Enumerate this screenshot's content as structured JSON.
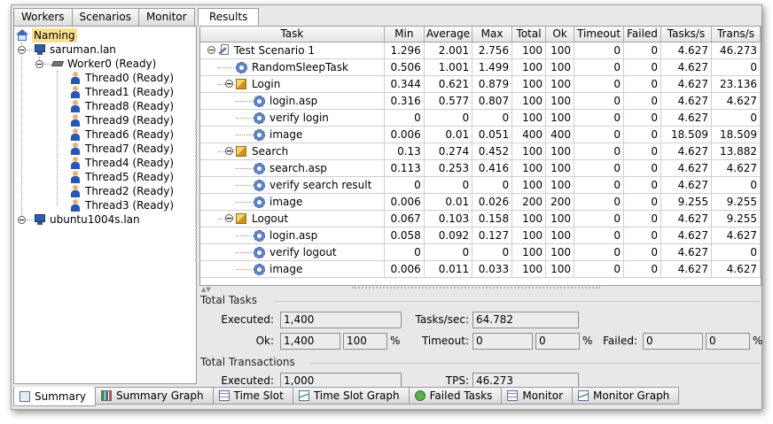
{
  "left_tabs": [
    "Workers",
    "Scenarios",
    "Monitor"
  ],
  "right_tab": "Results",
  "tree": {
    "root": "Naming",
    "hosts": [
      {
        "name": "saruman.lan",
        "worker": "Worker0 (Ready)",
        "threads": [
          "Thread0 (Ready)",
          "Thread1 (Ready)",
          "Thread8 (Ready)",
          "Thread9 (Ready)",
          "Thread6 (Ready)",
          "Thread7 (Ready)",
          "Thread4 (Ready)",
          "Thread5 (Ready)",
          "Thread2 (Ready)",
          "Thread3 (Ready)"
        ]
      },
      {
        "name": "ubuntu1004s.lan"
      }
    ]
  },
  "table": {
    "columns": [
      "Task",
      "Min",
      "Average",
      "Max",
      "Total",
      "Ok",
      "Timeout",
      "Failed",
      "Tasks/s",
      "Trans/s"
    ],
    "rows": [
      {
        "task": "Test Scenario 1",
        "icon": "scenario",
        "min": "1.296",
        "avg": "2.001",
        "max": "2.756",
        "total": "100",
        "ok": "100",
        "timeout": "0",
        "failed": "0",
        "tps": "4.627",
        "trans": "46.273"
      },
      {
        "task": "RandomSleepTask",
        "icon": "gear",
        "min": "0.506",
        "avg": "1.001",
        "max": "1.499",
        "total": "100",
        "ok": "100",
        "timeout": "0",
        "failed": "0",
        "tps": "4.627",
        "trans": "0"
      },
      {
        "task": "Login",
        "icon": "cube",
        "min": "0.344",
        "avg": "0.621",
        "max": "0.879",
        "total": "100",
        "ok": "100",
        "timeout": "0",
        "failed": "0",
        "tps": "4.627",
        "trans": "23.136"
      },
      {
        "task": "login.asp",
        "icon": "gear",
        "min": "0.316",
        "avg": "0.577",
        "max": "0.807",
        "total": "100",
        "ok": "100",
        "timeout": "0",
        "failed": "0",
        "tps": "4.627",
        "trans": "4.627"
      },
      {
        "task": "verify login",
        "icon": "gear",
        "min": "0",
        "avg": "0",
        "max": "0",
        "total": "100",
        "ok": "100",
        "timeout": "0",
        "failed": "0",
        "tps": "4.627",
        "trans": "0"
      },
      {
        "task": "image",
        "icon": "gear",
        "min": "0.006",
        "avg": "0.01",
        "max": "0.051",
        "total": "400",
        "ok": "400",
        "timeout": "0",
        "failed": "0",
        "tps": "18.509",
        "trans": "18.509"
      },
      {
        "task": "Search",
        "icon": "cube",
        "min": "0.13",
        "avg": "0.274",
        "max": "0.452",
        "total": "100",
        "ok": "100",
        "timeout": "0",
        "failed": "0",
        "tps": "4.627",
        "trans": "13.882"
      },
      {
        "task": "search.asp",
        "icon": "gear",
        "min": "0.113",
        "avg": "0.253",
        "max": "0.416",
        "total": "100",
        "ok": "100",
        "timeout": "0",
        "failed": "0",
        "tps": "4.627",
        "trans": "4.627"
      },
      {
        "task": "verify search result",
        "icon": "gear",
        "min": "0",
        "avg": "0",
        "max": "0",
        "total": "100",
        "ok": "100",
        "timeout": "0",
        "failed": "0",
        "tps": "4.627",
        "trans": "0"
      },
      {
        "task": "image",
        "icon": "gear",
        "min": "0.006",
        "avg": "0.01",
        "max": "0.026",
        "total": "200",
        "ok": "200",
        "timeout": "0",
        "failed": "0",
        "tps": "9.255",
        "trans": "9.255"
      },
      {
        "task": "Logout",
        "icon": "cube",
        "min": "0.067",
        "avg": "0.103",
        "max": "0.158",
        "total": "100",
        "ok": "100",
        "timeout": "0",
        "failed": "0",
        "tps": "4.627",
        "trans": "9.255"
      },
      {
        "task": "login.asp",
        "icon": "gear",
        "min": "0.058",
        "avg": "0.092",
        "max": "0.127",
        "total": "100",
        "ok": "100",
        "timeout": "0",
        "failed": "0",
        "tps": "4.627",
        "trans": "4.627"
      },
      {
        "task": "verify logout",
        "icon": "gear",
        "min": "0",
        "avg": "0",
        "max": "0",
        "total": "100",
        "ok": "100",
        "timeout": "0",
        "failed": "0",
        "tps": "4.627",
        "trans": "0"
      },
      {
        "task": "image",
        "icon": "gear",
        "min": "0.006",
        "avg": "0.011",
        "max": "0.033",
        "total": "100",
        "ok": "100",
        "timeout": "0",
        "failed": "0",
        "tps": "4.627",
        "trans": "4.627"
      }
    ]
  },
  "summary": {
    "total_tasks_title": "Total Tasks",
    "executed_label": "Executed:",
    "executed_value": "1,400",
    "tasks_per_sec_label": "Tasks/sec:",
    "tasks_per_sec_value": "64.782",
    "ok_label": "Ok:",
    "ok_value": "1,400",
    "ok_pct": "100",
    "pct_sign": "%",
    "timeout_label": "Timeout:",
    "timeout_value": "0",
    "timeout_pct": "0",
    "failed_label": "Failed:",
    "failed_value": "0",
    "failed_pct": "0",
    "total_trans_title": "Total Transactions",
    "trans_executed_label": "Executed:",
    "trans_executed_value": "1,000",
    "tps_label": "TPS:",
    "tps_value": "46.273"
  },
  "bottom_tabs": [
    {
      "label": "Summary",
      "icon": "summary-icon"
    },
    {
      "label": "Summary Graph",
      "icon": "bar-chart-icon"
    },
    {
      "label": "Time Slot",
      "icon": "grid-icon"
    },
    {
      "label": "Time Slot Graph",
      "icon": "line-graph-icon"
    },
    {
      "label": "Failed Tasks",
      "icon": "failed-icon"
    },
    {
      "label": "Monitor",
      "icon": "grid-icon"
    },
    {
      "label": "Monitor Graph",
      "icon": "line-graph-icon"
    }
  ]
}
